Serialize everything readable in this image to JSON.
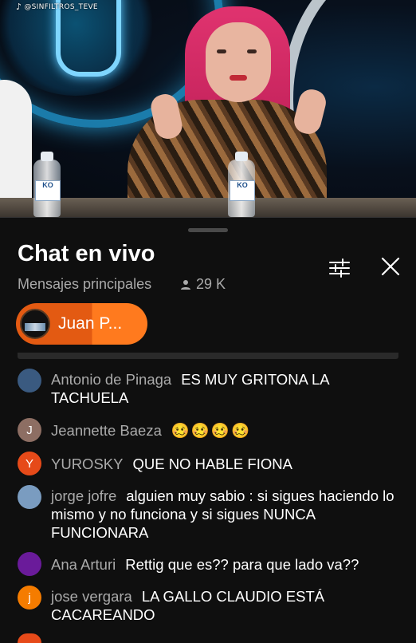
{
  "video": {
    "watermark": "@SINFILTROS_TEVE",
    "bottle_label": "KO"
  },
  "chat": {
    "title": "Chat en vivo",
    "mode": "Mensajes principales",
    "viewers": "29 K",
    "pinned_label": "Juan P..."
  },
  "messages": [
    {
      "author": "Antonio de Pinaga",
      "text": "ES MUY GRITONA LA TACHUELA",
      "avatar_letter": "",
      "avatar_color": "#3a5a80"
    },
    {
      "author": "Jeannette Baeza",
      "text": "🥴🥴🥴🥴",
      "avatar_letter": "J",
      "avatar_color": "#8d6e63"
    },
    {
      "author": "YUROSKY",
      "text": "QUE NO HABLE FIONA",
      "avatar_letter": "Y",
      "avatar_color": "#e64a19"
    },
    {
      "author": "jorge jofre",
      "text": "alguien muy sabio : si sigues haciendo lo mismo y no funciona y si sigues NUNCA FUNCIONARA",
      "avatar_letter": "",
      "avatar_color": "#7a9cc0"
    },
    {
      "author": "Ana Arturi",
      "text": "Rettig que es?? para que lado va??",
      "avatar_letter": "",
      "avatar_color": "#6a1b9a"
    },
    {
      "author": "jose vergara",
      "text": "LA GALLO CLAUDIO ESTÁ CACAREANDO",
      "avatar_letter": "j",
      "avatar_color": "#f57c00"
    }
  ],
  "colors": {
    "background": "#0f0f0f",
    "author_text": "#aaaaaa",
    "pill_orange": "#e35a12"
  }
}
